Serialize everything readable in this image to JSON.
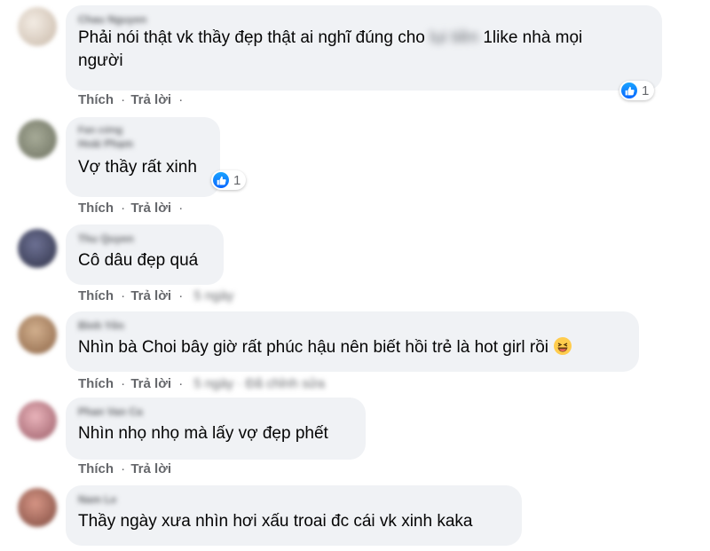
{
  "comments": [
    {
      "author": "Chau Nguyen",
      "text_line1_before": "Phải nói thật vk thầy đẹp thật ai nghĩ đúng cho",
      "text_line1_hidden": "lụi tiền",
      "text_line1_after": "1like nhà mọi",
      "text_line2": "người",
      "actions": {
        "like": "Thích",
        "reply": "Trả lời",
        "sep": "·"
      },
      "reaction_count": "1",
      "avatar_color": "#d9cfc4"
    },
    {
      "author_badge": "Fan cứng",
      "author": "Hoài Phạm",
      "text": "Vợ thầy rất xinh",
      "actions": {
        "like": "Thích",
        "reply": "Trả lời",
        "sep": "·"
      },
      "reaction_count": "1",
      "avatar_color": "#8a8f7c"
    },
    {
      "author": "Thu Quyen",
      "text": "Cô dâu đẹp quá",
      "actions": {
        "like": "Thích",
        "reply": "Trả lời",
        "sep": "·"
      },
      "time": "5 ngày",
      "avatar_color": "#4b4f6b"
    },
    {
      "author": "Bình Yên",
      "text": "Nhìn bà Choi bây giờ rất phúc hậu nên biết hồi trẻ là hot girl rồi",
      "emoji": "laughing-face",
      "actions": {
        "like": "Thích",
        "reply": "Trả lời",
        "sep": "·"
      },
      "time": "5 ngày · Đã chỉnh sửa",
      "avatar_color": "#b58f6e"
    },
    {
      "author": "Phan Van Ca",
      "text": "Nhìn nhọ nhọ mà lấy vợ đẹp phết",
      "actions": {
        "like": "Thích",
        "reply": "Trả lời",
        "sep": "·"
      },
      "avatar_color": "#c98b92"
    },
    {
      "author": "Nam Le",
      "text": "Thầy ngày xưa nhìn hơi xấu troai đc cái vk xinh kaka",
      "avatar_color": "#a86b5e"
    }
  ],
  "colors": {
    "bubble": "#f0f2f5",
    "meta": "#65676b",
    "like_blue": "#0866ff"
  }
}
